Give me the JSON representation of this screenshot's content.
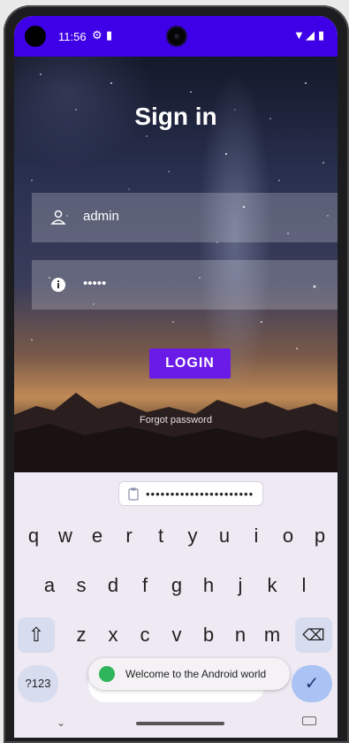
{
  "status_bar": {
    "time": "11:56",
    "icons": [
      "settings-icon",
      "sim-icon",
      "wifi-icon",
      "signal-icon",
      "battery-icon"
    ]
  },
  "screen": {
    "title": "Sign in",
    "username_value": "admin",
    "password_value": "•••••",
    "login_label": "LOGIN",
    "forgot_label": "Forgot password"
  },
  "keyboard": {
    "suggestion": "••••••••••••••••••••••",
    "rows": [
      [
        "q",
        "w",
        "e",
        "r",
        "t",
        "y",
        "u",
        "i",
        "o",
        "p"
      ],
      [
        "a",
        "s",
        "d",
        "f",
        "g",
        "h",
        "j",
        "k",
        "l"
      ],
      [
        "z",
        "x",
        "c",
        "v",
        "b",
        "n",
        "m"
      ]
    ],
    "symbols_label": "?123",
    "enter_label": "✓"
  },
  "toast": {
    "message": "Welcome to the Android world"
  },
  "colors": {
    "status_bar": "#3e00e6",
    "login_button": "#6a1be8",
    "toast_icon": "#2fb55a",
    "enter_key": "#aac3f4"
  }
}
